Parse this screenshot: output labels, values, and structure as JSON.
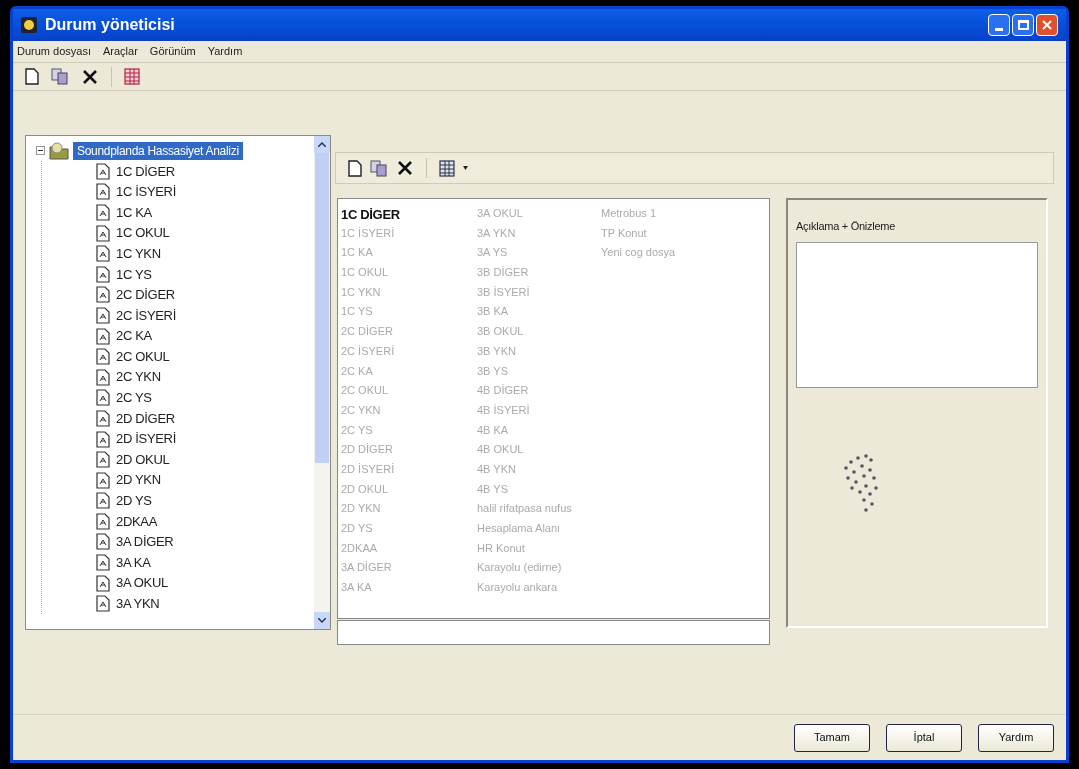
{
  "window": {
    "title": "Durum yöneticisi"
  },
  "menu": [
    {
      "label": "Durum dosyası"
    },
    {
      "label": "Araçlar"
    },
    {
      "label": "Görünüm"
    },
    {
      "label": "Yardım"
    }
  ],
  "tree": {
    "root": {
      "label": "Soundplanda Hassasiyet Analizi",
      "selected": true,
      "expanded": true,
      "children": [
        {
          "label": "1C DİGER"
        },
        {
          "label": "1C İSYERİ"
        },
        {
          "label": "1C KA"
        },
        {
          "label": "1C OKUL"
        },
        {
          "label": "1C YKN"
        },
        {
          "label": "1C YS"
        },
        {
          "label": "2C DİGER"
        },
        {
          "label": "2C İSYERİ"
        },
        {
          "label": "2C KA"
        },
        {
          "label": "2C OKUL"
        },
        {
          "label": "2C YKN"
        },
        {
          "label": "2C YS"
        },
        {
          "label": "2D DİGER"
        },
        {
          "label": "2D İSYERİ"
        },
        {
          "label": "2D OKUL"
        },
        {
          "label": "2D YKN"
        },
        {
          "label": "2D YS"
        },
        {
          "label": "2DKAA"
        },
        {
          "label": "3A DİGER"
        },
        {
          "label": "3A KA"
        },
        {
          "label": "3A OKUL"
        },
        {
          "label": "3A YKN"
        }
      ]
    }
  },
  "list": {
    "items": [
      {
        "label": "1C DİGER",
        "selected": true
      },
      {
        "label": "1C İSYERİ",
        "selected": false
      },
      {
        "label": "1C KA",
        "selected": false
      },
      {
        "label": "1C OKUL",
        "selected": false
      },
      {
        "label": "1C YKN",
        "selected": false
      },
      {
        "label": "1C YS",
        "selected": false
      },
      {
        "label": "2C DİGER",
        "selected": false
      },
      {
        "label": "2C İSYERİ",
        "selected": false
      },
      {
        "label": "2C KA",
        "selected": false
      },
      {
        "label": "2C OKUL",
        "selected": false
      },
      {
        "label": "2C YKN",
        "selected": false
      },
      {
        "label": "2C YS",
        "selected": false
      },
      {
        "label": "2D DİGER",
        "selected": false
      },
      {
        "label": "2D İSYERİ",
        "selected": false
      },
      {
        "label": "2D OKUL",
        "selected": false
      },
      {
        "label": "2D YKN",
        "selected": false
      },
      {
        "label": "2D YS",
        "selected": false
      },
      {
        "label": "2DKAA",
        "selected": false
      },
      {
        "label": "3A DİGER",
        "selected": false
      },
      {
        "label": "3A KA",
        "selected": false
      },
      {
        "label": "3A OKUL",
        "selected": false
      },
      {
        "label": "3A YKN",
        "selected": false
      },
      {
        "label": "3A YS",
        "selected": false
      },
      {
        "label": "3B DİGER",
        "selected": false
      },
      {
        "label": "3B İSYERİ",
        "selected": false
      },
      {
        "label": "3B KA",
        "selected": false
      },
      {
        "label": "3B OKUL",
        "selected": false
      },
      {
        "label": "3B YKN",
        "selected": false
      },
      {
        "label": "3B YS",
        "selected": false
      },
      {
        "label": "4B DİGER",
        "selected": false
      },
      {
        "label": "4B İSYERİ",
        "selected": false
      },
      {
        "label": "4B KA",
        "selected": false
      },
      {
        "label": "4B OKUL",
        "selected": false
      },
      {
        "label": "4B YKN",
        "selected": false
      },
      {
        "label": "4B YS",
        "selected": false
      },
      {
        "label": "halil rifatpasa nufus",
        "selected": false
      },
      {
        "label": "Hesaplama Alanı",
        "selected": false
      },
      {
        "label": "HR Konut",
        "selected": false
      },
      {
        "label": "Karayolu (edirne)",
        "selected": false
      },
      {
        "label": "Karayolu ankara",
        "selected": false
      },
      {
        "label": "Metrobus 1",
        "selected": false
      },
      {
        "label": "TP Konut",
        "selected": false
      },
      {
        "label": "Yeni cog dosya",
        "selected": false
      }
    ]
  },
  "preview": {
    "title": "Açıklama + Önizleme"
  },
  "buttons": [
    {
      "label": "Tamam"
    },
    {
      "label": "İptal"
    },
    {
      "label": "Yardım"
    }
  ]
}
